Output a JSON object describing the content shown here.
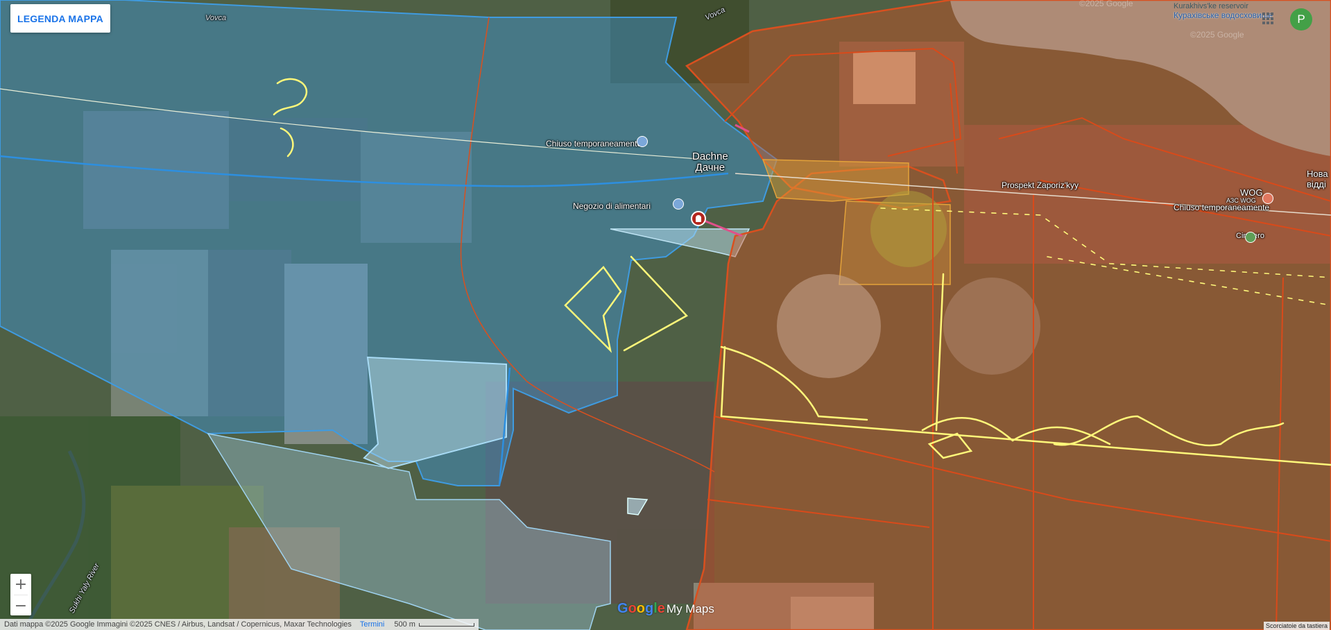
{
  "legend_button": {
    "label": "LEGENDA MAPPA"
  },
  "avatar": {
    "letter": "P",
    "color": "#43a047"
  },
  "map_labels": {
    "vovca_top": "Vovca",
    "vovca_right": "Vovca",
    "dachne_latin": "Dachne",
    "dachne_cyrillic": "Дачне",
    "closed_1": "Chiuso temporaneamente",
    "closed_2": "Chiuso temporaneamente",
    "grocery": "Negozio di alimentari",
    "prospekt": "Prospekt Zaporiz'kyy",
    "wog": "WOG",
    "wog_small": "АЗС WOG",
    "cemetery": "Cimitero",
    "reservoir_en": "Kurakhivs'ke reservoir",
    "reservoir_uk": "Курахівське водосховище",
    "nova": "Нова",
    "viddi": "відді",
    "river": "Sukhi Yaly River",
    "copyright_ghost": "©2025 Google",
    "copyright_ghost2": "©2025 Google"
  },
  "zoom": {
    "in_label": "+",
    "out_label": "−"
  },
  "footer": {
    "attribution": "Dati mappa ©2025 Google Immagini ©2025 CNES / Airbus, Landsat / Copernicus, Maxar Technologies",
    "terms": "Termini",
    "scale": "500 m",
    "keyboard": "Scorciatoie da tastiera"
  },
  "brand": {
    "google": "Google",
    "mymaps": "My Maps"
  },
  "colors": {
    "ukraine_zone": "#3f9be0",
    "russia_zone": "#d9501f",
    "contested_zone": "#e3a23a",
    "trenches": "#fff87a",
    "reservoir": "#8fb6b6"
  },
  "icons": [
    "grid-icon",
    "avatar",
    "zoom-in-icon",
    "zoom-out-icon",
    "position-pin-icon",
    "poi-icon"
  ]
}
